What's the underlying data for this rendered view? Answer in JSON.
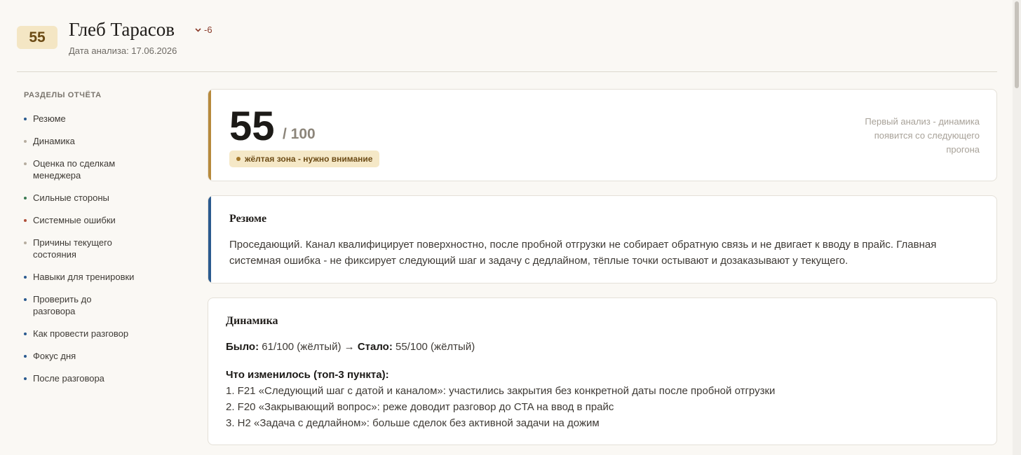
{
  "header": {
    "score": "55",
    "name": "Глеб Тарасов",
    "delta": "-6",
    "date": "Дата анализа: 17.06.2026"
  },
  "sidebar": {
    "title": "РАЗДЕЛЫ ОТЧЁТА",
    "items": [
      {
        "label": "Резюме",
        "color": "#2a5a8f"
      },
      {
        "label": "Динамика",
        "color": "#b6ad9f"
      },
      {
        "label": "Оценка по сделкам менеджера",
        "color": "#b6ad9f"
      },
      {
        "label": "Сильные стороны",
        "color": "#3a7a52"
      },
      {
        "label": "Системные ошибки",
        "color": "#b0503a"
      },
      {
        "label": "Причины текущего состояния",
        "color": "#b6ad9f"
      },
      {
        "label": "Навыки для тренировки",
        "color": "#2a5a8f"
      },
      {
        "label": "Проверить до разговора",
        "color": "#2a5a8f"
      },
      {
        "label": "Как провести разговор",
        "color": "#2a5a8f"
      },
      {
        "label": "Фокус дня",
        "color": "#2a5a8f"
      },
      {
        "label": "После разговора",
        "color": "#2a5a8f"
      }
    ]
  },
  "score_card": {
    "score": "55",
    "out_of": "/ 100",
    "zone": "жёлтая зона - нужно внимание",
    "note": "Первый анализ - динамика появится со следующего прогона",
    "accent": "#b78a3c"
  },
  "resume": {
    "title": "Резюме",
    "text": "Проседающий. Канал квалифицирует поверхностно, после пробной отгрузки не собирает обратную связь и не двигает к вводу в прайс. Главная системная ошибка - не фиксирует следующий шаг и задачу с дедлайном, тёплые точки остывают и дозаказывают у текущего.",
    "accent": "#2a5a8f"
  },
  "dynamics": {
    "title": "Динамика",
    "was_label": "Было:",
    "was_value": "61/100 (жёлтый)",
    "arrow": "→",
    "now_label": "Стало:",
    "now_value": "55/100 (жёлтый)",
    "changed_title": "Что изменилось (топ-3 пункта):",
    "changes": [
      "1. F21 «Следующий шаг с датой и каналом»: участились закрытия без конкретной даты после пробной отгрузки",
      "2. F20 «Закрывающий вопрос»: реже доводит разговор до CTA на ввод в прайс",
      "3. H2 «Задача с дедлайном»: больше сделок без активной задачи на дожим"
    ]
  }
}
